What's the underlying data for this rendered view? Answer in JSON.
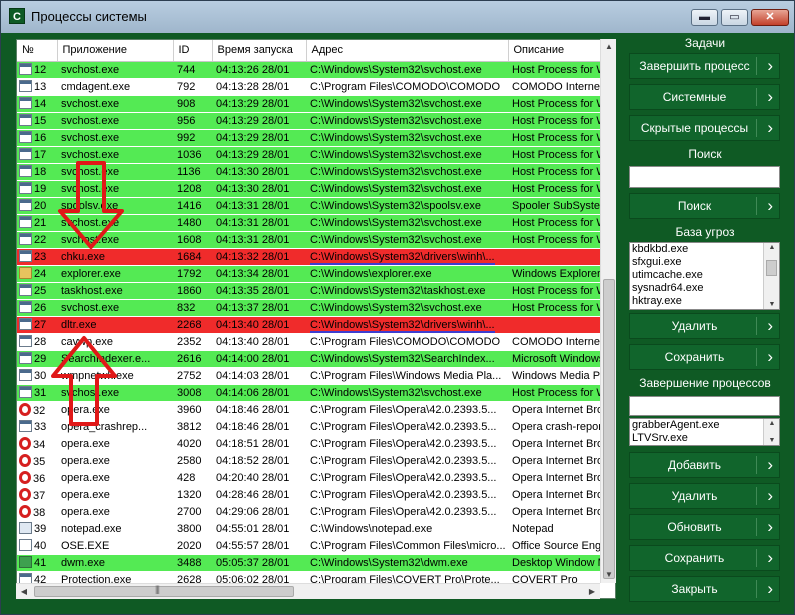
{
  "window": {
    "title": "Процессы системы",
    "icon_letter": "C",
    "min_glyph": "▬",
    "max_glyph": "▭",
    "close_glyph": "✕"
  },
  "table": {
    "headers": [
      "№",
      "Приложение",
      "ID",
      "Время запуска",
      "Адрес",
      "Описание"
    ],
    "rows": [
      {
        "icon": "win",
        "num": "12",
        "app": "svchost.exe",
        "id": "744",
        "time": "04:13:26  28/01",
        "addr": "C:\\Windows\\System32\\svchost.exe",
        "desc": "Host Process for Wind",
        "color": "green"
      },
      {
        "icon": "win",
        "num": "13",
        "app": "cmdagent.exe",
        "id": "792",
        "time": "04:13:28  28/01",
        "addr": "C:\\Program Files\\COMODO\\COMODO",
        "desc": "COMODO Internet Se",
        "color": "white"
      },
      {
        "icon": "win",
        "num": "14",
        "app": "svchost.exe",
        "id": "908",
        "time": "04:13:29  28/01",
        "addr": "C:\\Windows\\System32\\svchost.exe",
        "desc": "Host Process for Wind",
        "color": "green"
      },
      {
        "icon": "win",
        "num": "15",
        "app": "svchost.exe",
        "id": "956",
        "time": "04:13:29  28/01",
        "addr": "C:\\Windows\\System32\\svchost.exe",
        "desc": "Host Process for Wind",
        "color": "green"
      },
      {
        "icon": "win",
        "num": "16",
        "app": "svchost.exe",
        "id": "992",
        "time": "04:13:29  28/01",
        "addr": "C:\\Windows\\System32\\svchost.exe",
        "desc": "Host Process for Wind",
        "color": "green"
      },
      {
        "icon": "win",
        "num": "17",
        "app": "svchost.exe",
        "id": "1036",
        "time": "04:13:29  28/01",
        "addr": "C:\\Windows\\System32\\svchost.exe",
        "desc": "Host Process for Wind",
        "color": "green"
      },
      {
        "icon": "win",
        "num": "18",
        "app": "svchost.exe",
        "id": "1136",
        "time": "04:13:30  28/01",
        "addr": "C:\\Windows\\System32\\svchost.exe",
        "desc": "Host Process for Wind",
        "color": "green"
      },
      {
        "icon": "win",
        "num": "19",
        "app": "svchost.exe",
        "id": "1208",
        "time": "04:13:30  28/01",
        "addr": "C:\\Windows\\System32\\svchost.exe",
        "desc": "Host Process for Wind",
        "color": "green"
      },
      {
        "icon": "win",
        "num": "20",
        "app": "spoolsv.exe",
        "id": "1416",
        "time": "04:13:31  28/01",
        "addr": "C:\\Windows\\System32\\spoolsv.exe",
        "desc": "Spooler SubSystem A",
        "color": "green"
      },
      {
        "icon": "win",
        "num": "21",
        "app": "svchost.exe",
        "id": "1480",
        "time": "04:13:31  28/01",
        "addr": "C:\\Windows\\System32\\svchost.exe",
        "desc": "Host Process for Wind",
        "color": "green"
      },
      {
        "icon": "win",
        "num": "22",
        "app": "svchost.exe",
        "id": "1608",
        "time": "04:13:31  28/01",
        "addr": "C:\\Windows\\System32\\svchost.exe",
        "desc": "Host Process for Wind",
        "color": "green"
      },
      {
        "icon": "win",
        "num": "23",
        "app": "chku.exe",
        "id": "1684",
        "time": "04:13:32  28/01",
        "addr": "C:\\Windows\\System32\\drivers\\winh\\...",
        "desc": "",
        "color": "red",
        "underline": true
      },
      {
        "icon": "folder",
        "num": "24",
        "app": "explorer.exe",
        "id": "1792",
        "time": "04:13:34  28/01",
        "addr": "C:\\Windows\\explorer.exe",
        "desc": "Windows Explorer",
        "color": "green"
      },
      {
        "icon": "win",
        "num": "25",
        "app": "taskhost.exe",
        "id": "1860",
        "time": "04:13:35  28/01",
        "addr": "C:\\Windows\\System32\\taskhost.exe",
        "desc": "Host Process for Wind",
        "color": "green"
      },
      {
        "icon": "win",
        "num": "26",
        "app": "svchost.exe",
        "id": "832",
        "time": "04:13:37  28/01",
        "addr": "C:\\Windows\\System32\\svchost.exe",
        "desc": "Host Process for Wind",
        "color": "green"
      },
      {
        "icon": "win",
        "num": "27",
        "app": "dltr.exe",
        "id": "2268",
        "time": "04:13:40  28/01",
        "addr": "C:\\Windows\\System32\\drivers\\winh\\...",
        "desc": "",
        "color": "red",
        "underline": true
      },
      {
        "icon": "win",
        "num": "28",
        "app": "cavwp.exe",
        "id": "2352",
        "time": "04:13:40  28/01",
        "addr": "C:\\Program Files\\COMODO\\COMODO",
        "desc": "COMODO Internet Se",
        "color": "white"
      },
      {
        "icon": "win",
        "num": "29",
        "app": "SearchIndexer.e...",
        "id": "2616",
        "time": "04:14:00  28/01",
        "addr": "C:\\Windows\\System32\\SearchIndex...",
        "desc": "Microsoft Windows Se",
        "color": "green"
      },
      {
        "icon": "win",
        "num": "30",
        "app": "wmpnetwk.exe",
        "id": "2752",
        "time": "04:14:03  28/01",
        "addr": "C:\\Program Files\\Windows Media Pla...",
        "desc": "Windows Media Playe",
        "color": "white"
      },
      {
        "icon": "win",
        "num": "31",
        "app": "svchost.exe",
        "id": "3008",
        "time": "04:14:06  28/01",
        "addr": "C:\\Windows\\System32\\svchost.exe",
        "desc": "Host Process for Wind",
        "color": "green"
      },
      {
        "icon": "opera",
        "num": "32",
        "app": "opera.exe",
        "id": "3960",
        "time": "04:18:46  28/01",
        "addr": "C:\\Program Files\\Opera\\42.0.2393.5...",
        "desc": "Opera Internet Browse",
        "color": "white"
      },
      {
        "icon": "win",
        "num": "33",
        "app": "opera_crashrep...",
        "id": "3812",
        "time": "04:18:46  28/01",
        "addr": "C:\\Program Files\\Opera\\42.0.2393.5...",
        "desc": "Opera crash-reporter",
        "color": "white"
      },
      {
        "icon": "opera",
        "num": "34",
        "app": "opera.exe",
        "id": "4020",
        "time": "04:18:51  28/01",
        "addr": "C:\\Program Files\\Opera\\42.0.2393.5...",
        "desc": "Opera Internet Browse",
        "color": "white"
      },
      {
        "icon": "opera",
        "num": "35",
        "app": "opera.exe",
        "id": "2580",
        "time": "04:18:52  28/01",
        "addr": "C:\\Program Files\\Opera\\42.0.2393.5...",
        "desc": "Opera Internet Browse",
        "color": "white"
      },
      {
        "icon": "opera",
        "num": "36",
        "app": "opera.exe",
        "id": "428",
        "time": "04:20:40  28/01",
        "addr": "C:\\Program Files\\Opera\\42.0.2393.5...",
        "desc": "Opera Internet Browse",
        "color": "white"
      },
      {
        "icon": "opera",
        "num": "37",
        "app": "opera.exe",
        "id": "1320",
        "time": "04:28:46  28/01",
        "addr": "C:\\Program Files\\Opera\\42.0.2393.5...",
        "desc": "Opera Internet Browse",
        "color": "white"
      },
      {
        "icon": "opera",
        "num": "38",
        "app": "opera.exe",
        "id": "2700",
        "time": "04:29:06  28/01",
        "addr": "C:\\Program Files\\Opera\\42.0.2393.5...",
        "desc": "Opera Internet Browse",
        "color": "white"
      },
      {
        "icon": "note",
        "num": "39",
        "app": "notepad.exe",
        "id": "3800",
        "time": "04:55:01  28/01",
        "addr": "C:\\Windows\\notepad.exe",
        "desc": "Notepad",
        "color": "white"
      },
      {
        "icon": "ose",
        "num": "40",
        "app": "OSE.EXE",
        "id": "2020",
        "time": "04:55:57  28/01",
        "addr": "C:\\Program Files\\Common Files\\micro...",
        "desc": "Office Source Engine",
        "color": "white"
      },
      {
        "icon": "dwm",
        "num": "41",
        "app": "dwm.exe",
        "id": "3488",
        "time": "05:05:37  28/01",
        "addr": "C:\\Windows\\System32\\dwm.exe",
        "desc": "Desktop Window Man",
        "color": "green"
      },
      {
        "icon": "win",
        "num": "42",
        "app": "Protection.exe",
        "id": "2628",
        "time": "05:06:02  28/01",
        "addr": "C:\\Program Files\\COVERT Pro\\Prote...",
        "desc": "COVERT Pro",
        "color": "white"
      }
    ]
  },
  "right_panel": {
    "tasks_label": "Задачи",
    "btn_end_process": "Завершить процесс",
    "btn_system": "Системные",
    "btn_hidden": "Скрытые процессы",
    "search_label": "Поиск",
    "search_value": "",
    "btn_search": "Поиск",
    "threats_label": "База угроз",
    "threats": [
      "kbdkbd.exe",
      "sfxgui.exe",
      "utimcache.exe",
      "sysnadr64.exe",
      "hktray.exe"
    ],
    "btn_delete1": "Удалить",
    "btn_save1": "Сохранить",
    "termination_label": "Завершение процессов",
    "term_input_value": "",
    "term_list": [
      "grabberAgent.exe",
      "LTVSrv.exe"
    ],
    "btn_add": "Добавить",
    "btn_delete2": "Удалить",
    "btn_refresh": "Обновить",
    "btn_save2": "Сохранить",
    "btn_close": "Закрыть",
    "arrow_glyph": "›"
  },
  "colors": {
    "green_row": "#54ea54",
    "red_row": "#f02b2b",
    "panel_bg": "#0f5a24",
    "annotation_arrow": "#e01818"
  }
}
